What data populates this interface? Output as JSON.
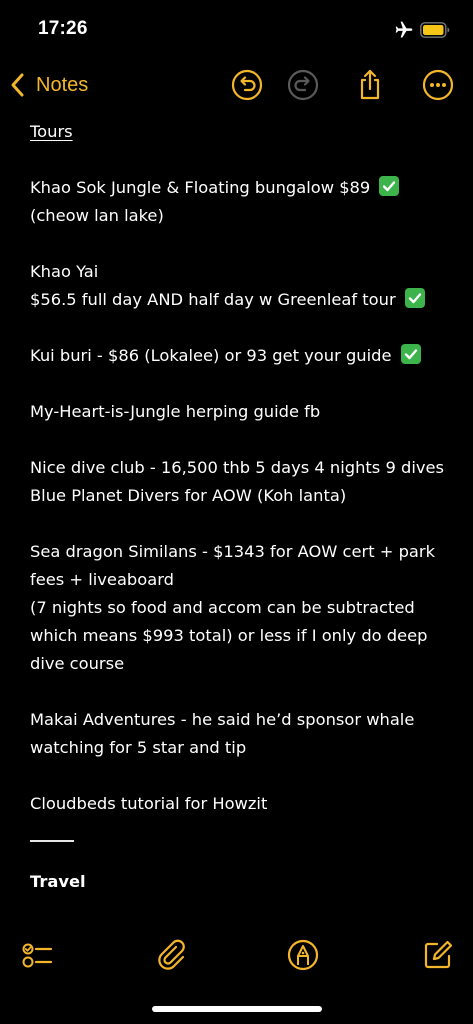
{
  "status_bar": {
    "time": "17:26",
    "airplane_icon": "airplane-icon",
    "battery_icon": "battery-icon",
    "battery_color": "#f5c518"
  },
  "nav": {
    "back_label": "Notes",
    "accent_color": "#f3b62a",
    "icons": [
      "chevron-left-icon",
      "undo-icon",
      "redo-icon",
      "share-icon",
      "more-icon"
    ]
  },
  "note": {
    "heading": "Tours",
    "lines": {
      "l1": "Khao Sok Jungle & Floating bungalow $89",
      "l2": "(cheow lan lake)",
      "l3": "Khao Yai",
      "l4": "$56.5 full day AND half day w Greenleaf tour",
      "l5": "Kui buri - $86 (Lokalee) or 93 get your guide",
      "l6": "My-Heart-is-Jungle herping guide fb",
      "l7": "Nice dive club - 16,500 thb 5 days 4 nights 9 dives",
      "l8": "Blue Planet Divers for AOW (Koh lanta)",
      "l9": "Sea dragon Similans - $1343 for AOW cert + park",
      "l10": "fees + liveaboard",
      "l11": "(7 nights so food and accom can be subtracted",
      "l12": "which means $993 total) or less if I only do deep",
      "l13": "dive course",
      "l14": "Makai Adventures - he said he’d sponsor whale",
      "l15": "watching for 5 star and tip",
      "l16": "Cloudbeds tutorial for Howzit"
    },
    "section_heading": "Travel",
    "check_color": "#3cb44b"
  },
  "toolbar": {
    "icons": [
      "checklist-icon",
      "paperclip-icon",
      "markup-pen-icon",
      "compose-icon"
    ]
  }
}
